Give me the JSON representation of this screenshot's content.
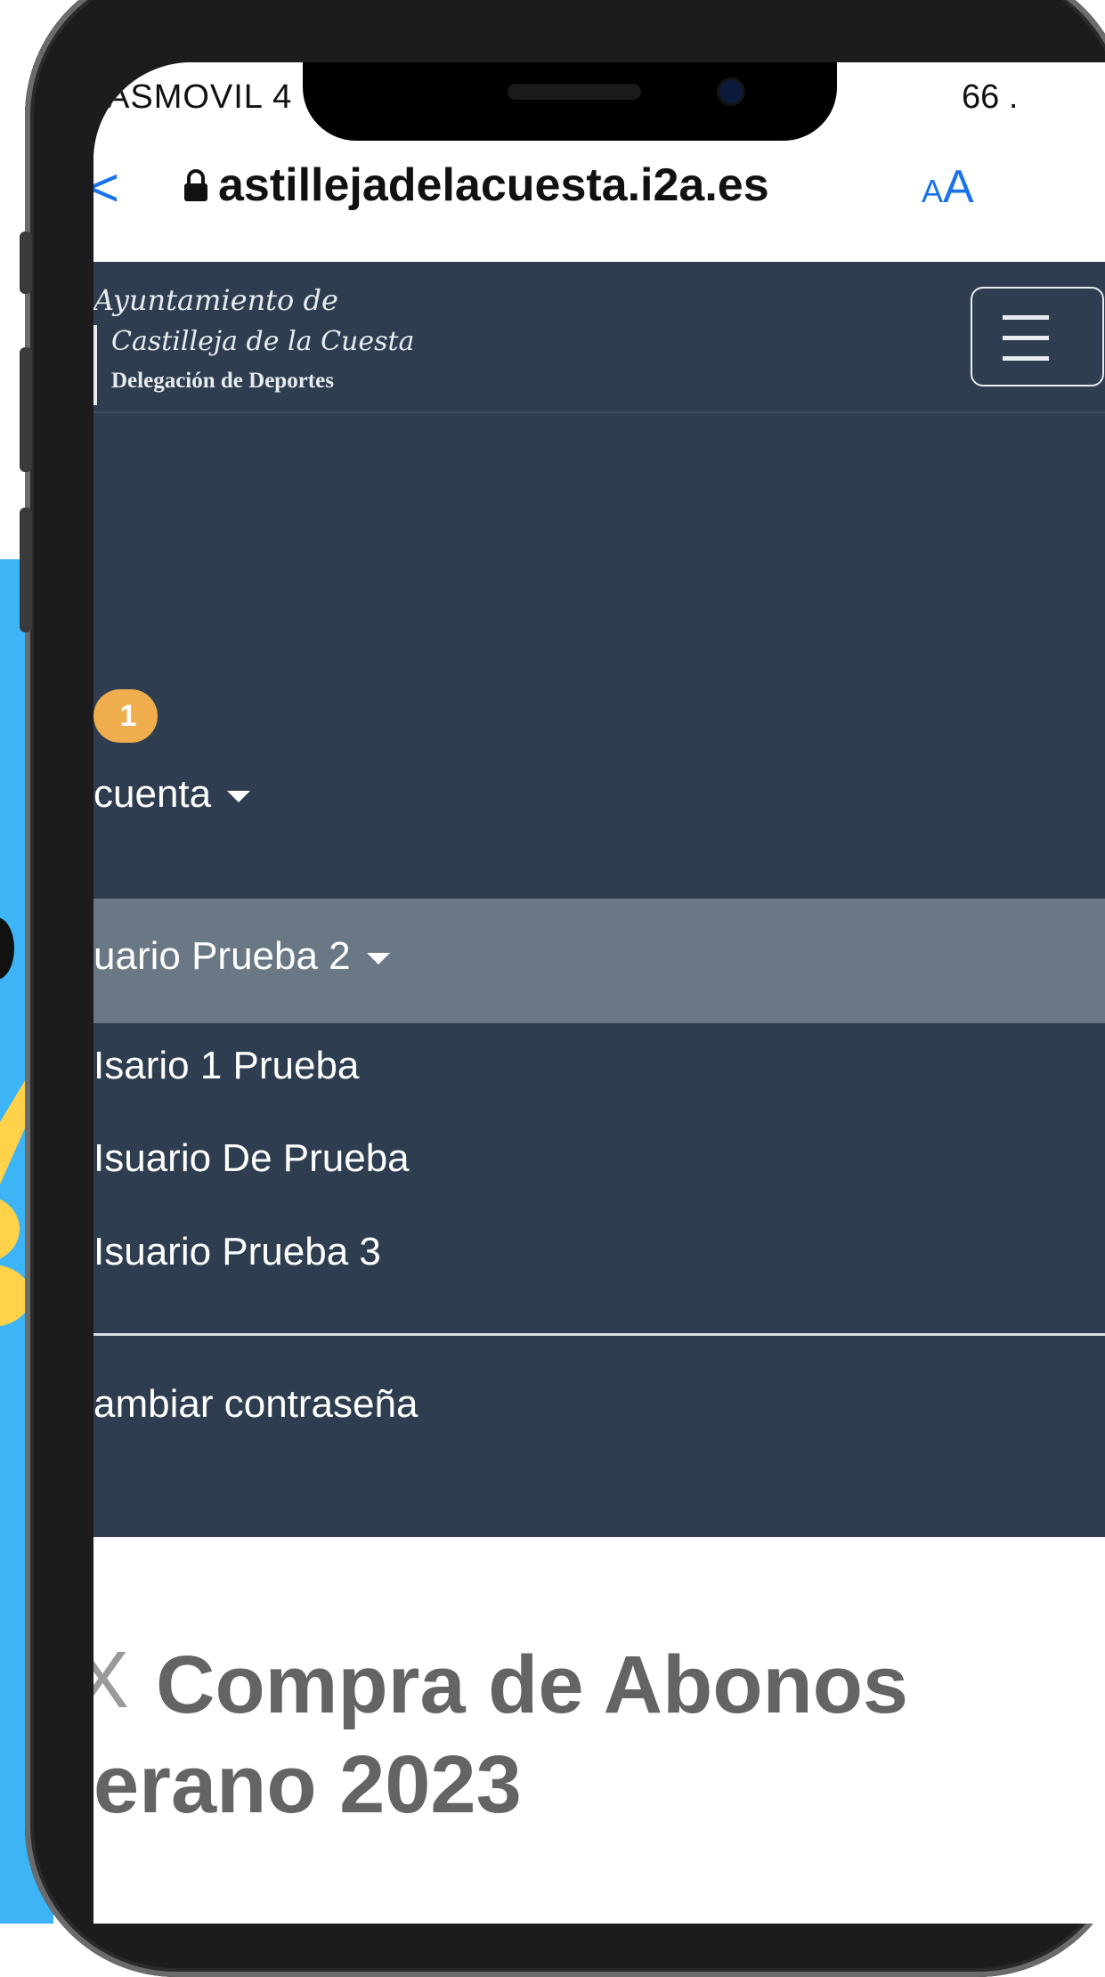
{
  "status_bar": {
    "carrier": "ASMOVIL 4",
    "battery": "66 ."
  },
  "browser": {
    "url": "astillejadelacuesta.i2a.es",
    "text_size_small": "A",
    "text_size_large": "A",
    "back": "<"
  },
  "header": {
    "logo": {
      "line1": "Ayuntamiento de",
      "line2": "Castilleja de la Cuesta",
      "line3": "Delegación de Deportes"
    }
  },
  "nav": {
    "badge_count": "1",
    "account_label": "cuenta",
    "active_user": "uario Prueba 2",
    "users": [
      "Isario 1 Prueba",
      "Isuario De Prueba",
      "Isuario Prueba 3"
    ],
    "change_password": "ambiar contraseña"
  },
  "page": {
    "title_line1": "Compra de Abonos",
    "title_line2": "erano 2023",
    "close_glyph": "X"
  },
  "colors": {
    "nav_bg": "#2e3e50",
    "active_bg": "#6a7886",
    "badge": "#f0ad4e",
    "link_blue": "#1a73e8",
    "side_card": "#3db4f6"
  }
}
